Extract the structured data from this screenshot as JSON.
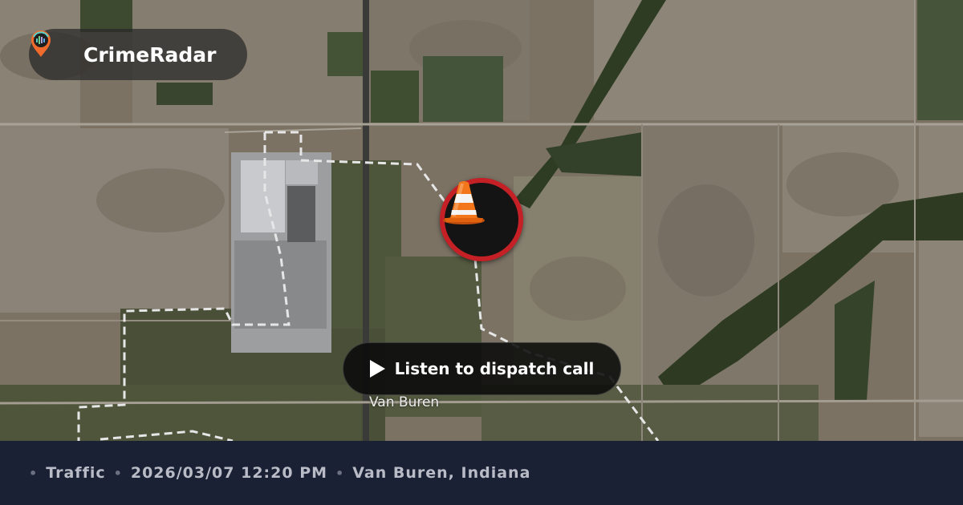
{
  "brand": {
    "name": "CrimeRadar",
    "logo_icon": "radar-pin-icon"
  },
  "map": {
    "place_label": "Van Buren",
    "marker_icon": "traffic-cone-icon",
    "marker_color": "#c42026"
  },
  "dispatch": {
    "button_label": "Listen to dispatch call",
    "icon": "play-icon"
  },
  "footer": {
    "category": "Traffic",
    "datetime": "2026/03/07 12:20 PM",
    "location": "Van Buren, Indiana"
  }
}
